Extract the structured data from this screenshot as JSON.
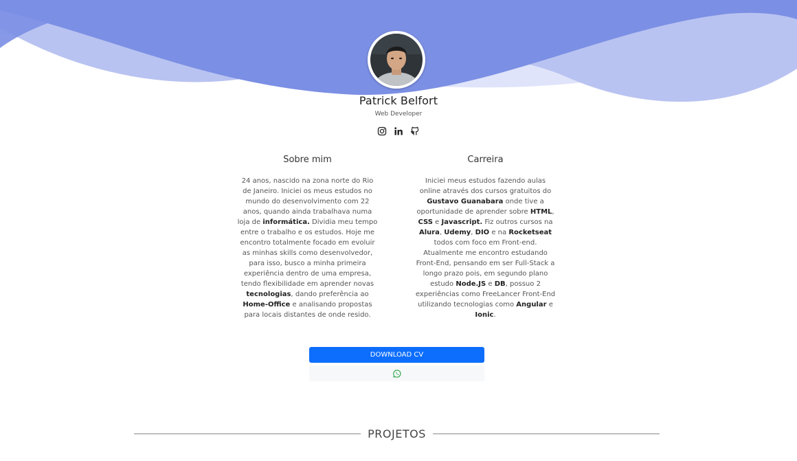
{
  "profile": {
    "name": "Patrick Belfort",
    "role": "Web Developer"
  },
  "socials": [
    {
      "icon": "instagram-icon"
    },
    {
      "icon": "linkedin-icon"
    },
    {
      "icon": "github-icon"
    }
  ],
  "about": {
    "title": "Sobre mim",
    "segments": [
      {
        "t": "24 anos, nascido na zona norte do Rio de Janeiro. Iniciei os meus estudos no mundo do desenvolvimento com 22 anos, quando ainda trabalhava numa loja de "
      },
      {
        "t": "informática.",
        "b": true
      },
      {
        "t": " Dividia meu tempo entre o trabalho e os estudos. Hoje me encontro totalmente focado em evoluir as minhas skills como desenvolvedor, para isso, busco a minha primeira experiência dentro de uma empresa, tendo flexibilidade em aprender novas "
      },
      {
        "t": "tecnologias",
        "b": true
      },
      {
        "t": ", dando preferência ao "
      },
      {
        "t": "Home-Office",
        "b": true
      },
      {
        "t": " e analisando propostas para locais distantes de onde resido."
      }
    ]
  },
  "career": {
    "title": "Carreira",
    "segments": [
      {
        "t": "Iniciei meus estudos fazendo aulas online através dos cursos gratuitos do "
      },
      {
        "t": "Gustavo Guanabara",
        "b": true
      },
      {
        "t": " onde tive a oportunidade de aprender sobre "
      },
      {
        "t": "HTML",
        "b": true
      },
      {
        "t": ", "
      },
      {
        "t": "CSS",
        "b": true
      },
      {
        "t": " e "
      },
      {
        "t": "Javascript.",
        "b": true
      },
      {
        "t": " Fiz outros cursos na "
      },
      {
        "t": "Alura",
        "b": true
      },
      {
        "t": ", "
      },
      {
        "t": "Udemy",
        "b": true
      },
      {
        "t": ", "
      },
      {
        "t": "DIO",
        "b": true
      },
      {
        "t": " e na "
      },
      {
        "t": "Rocketseat",
        "b": true
      },
      {
        "t": " todos com foco em Front-end. Atualmente me encontro estudando Front-End, pensando em ser Full-Stack a longo prazo pois, em segundo plano estudo "
      },
      {
        "t": "Node.JS",
        "b": true
      },
      {
        "t": " e "
      },
      {
        "t": "DB",
        "b": true
      },
      {
        "t": ", possuo 2 experiências como FreeLancer Front-End utilizando tecnologias como "
      },
      {
        "t": "Angular",
        "b": true
      },
      {
        "t": " e "
      },
      {
        "t": "Ionic",
        "b": true
      },
      {
        "t": "."
      }
    ]
  },
  "buttons": {
    "download_cv": "DOWNLOAD CV",
    "whatsapp_icon": "whatsapp-icon"
  },
  "sections": {
    "projects": "PROJETOS"
  },
  "colors": {
    "wave_main": "#7b8fe4",
    "wave_light": "#b9c3f1",
    "wave_pale": "#dfe4fa",
    "button_primary": "#0d6efd",
    "whatsapp": "#25a244"
  }
}
